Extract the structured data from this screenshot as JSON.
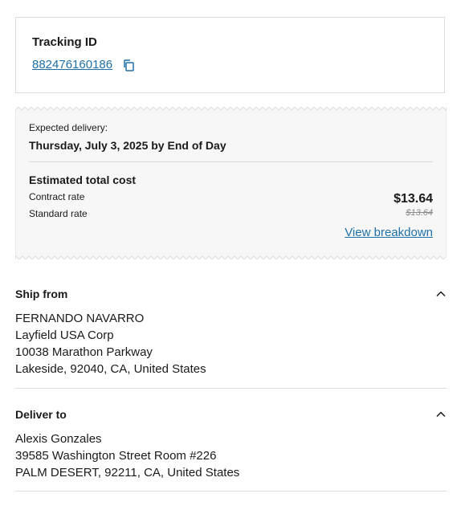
{
  "tracking": {
    "title": "Tracking ID",
    "id": "882476160186",
    "copy_icon": "copy-icon"
  },
  "delivery": {
    "expected_label": "Expected delivery:",
    "expected_date": "Thursday, July 3, 2025 by End of Day"
  },
  "cost": {
    "title": "Estimated total cost",
    "contract_label": "Contract rate",
    "standard_label": "Standard rate",
    "contract_price": "$13.64",
    "standard_price": "$13.64",
    "breakdown_link": "View breakdown"
  },
  "ship_from": {
    "title": "Ship from",
    "lines": [
      "FERNANDO NAVARRO",
      "Layfield USA Corp",
      "10038 Marathon Parkway",
      "Lakeside, 92040, CA, United States"
    ],
    "expanded_icon": "chevron-up-icon"
  },
  "deliver_to": {
    "title": "Deliver to",
    "lines": [
      "Alexis Gonzales",
      "39585 Washington Street Room #226",
      "PALM DESERT, 92211, CA, United States"
    ],
    "expanded_icon": "chevron-up-icon"
  },
  "colors": {
    "link": "#1f6fa8",
    "receipt_bg": "#f7f7f7",
    "border": "#dcdcdc"
  }
}
